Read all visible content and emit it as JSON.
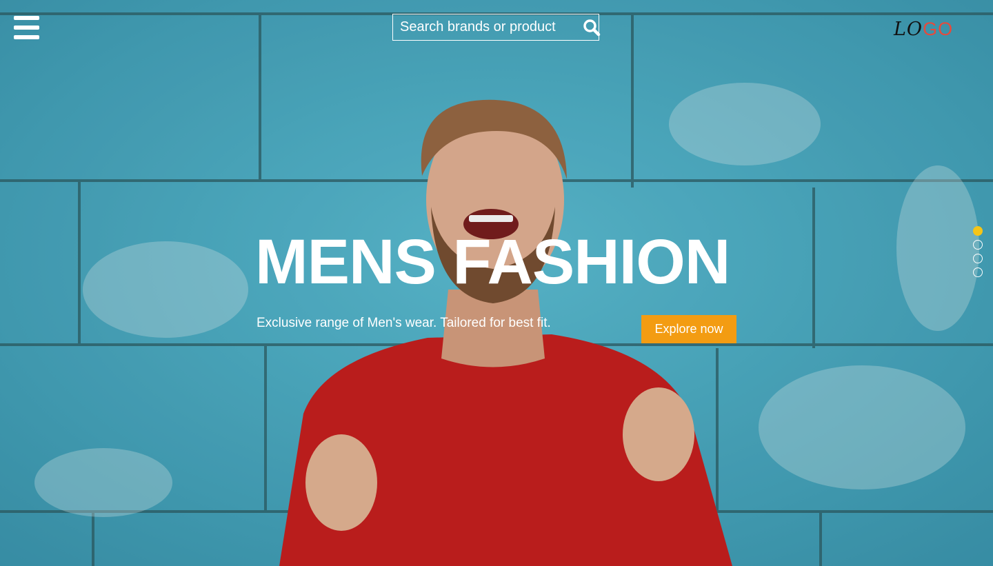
{
  "header": {
    "search": {
      "placeholder": "Search brands or product",
      "value": ""
    },
    "logo": {
      "part1": "LO",
      "part2": "GO"
    }
  },
  "hero": {
    "title": "MENS FASHION",
    "subtitle": "Exclusive range of Men's wear. Tailored for best fit.",
    "cta_label": "Explore now"
  },
  "slider": {
    "slide_count": 4,
    "active_index": 0
  },
  "colors": {
    "accent": "#f39c12",
    "active_dot": "#f5c518",
    "logo_accent": "#e64a3c",
    "wall": "#4fb0c6",
    "sweater": "#c9201f"
  },
  "icons": {
    "menu": "hamburger-icon",
    "search": "search-icon"
  }
}
